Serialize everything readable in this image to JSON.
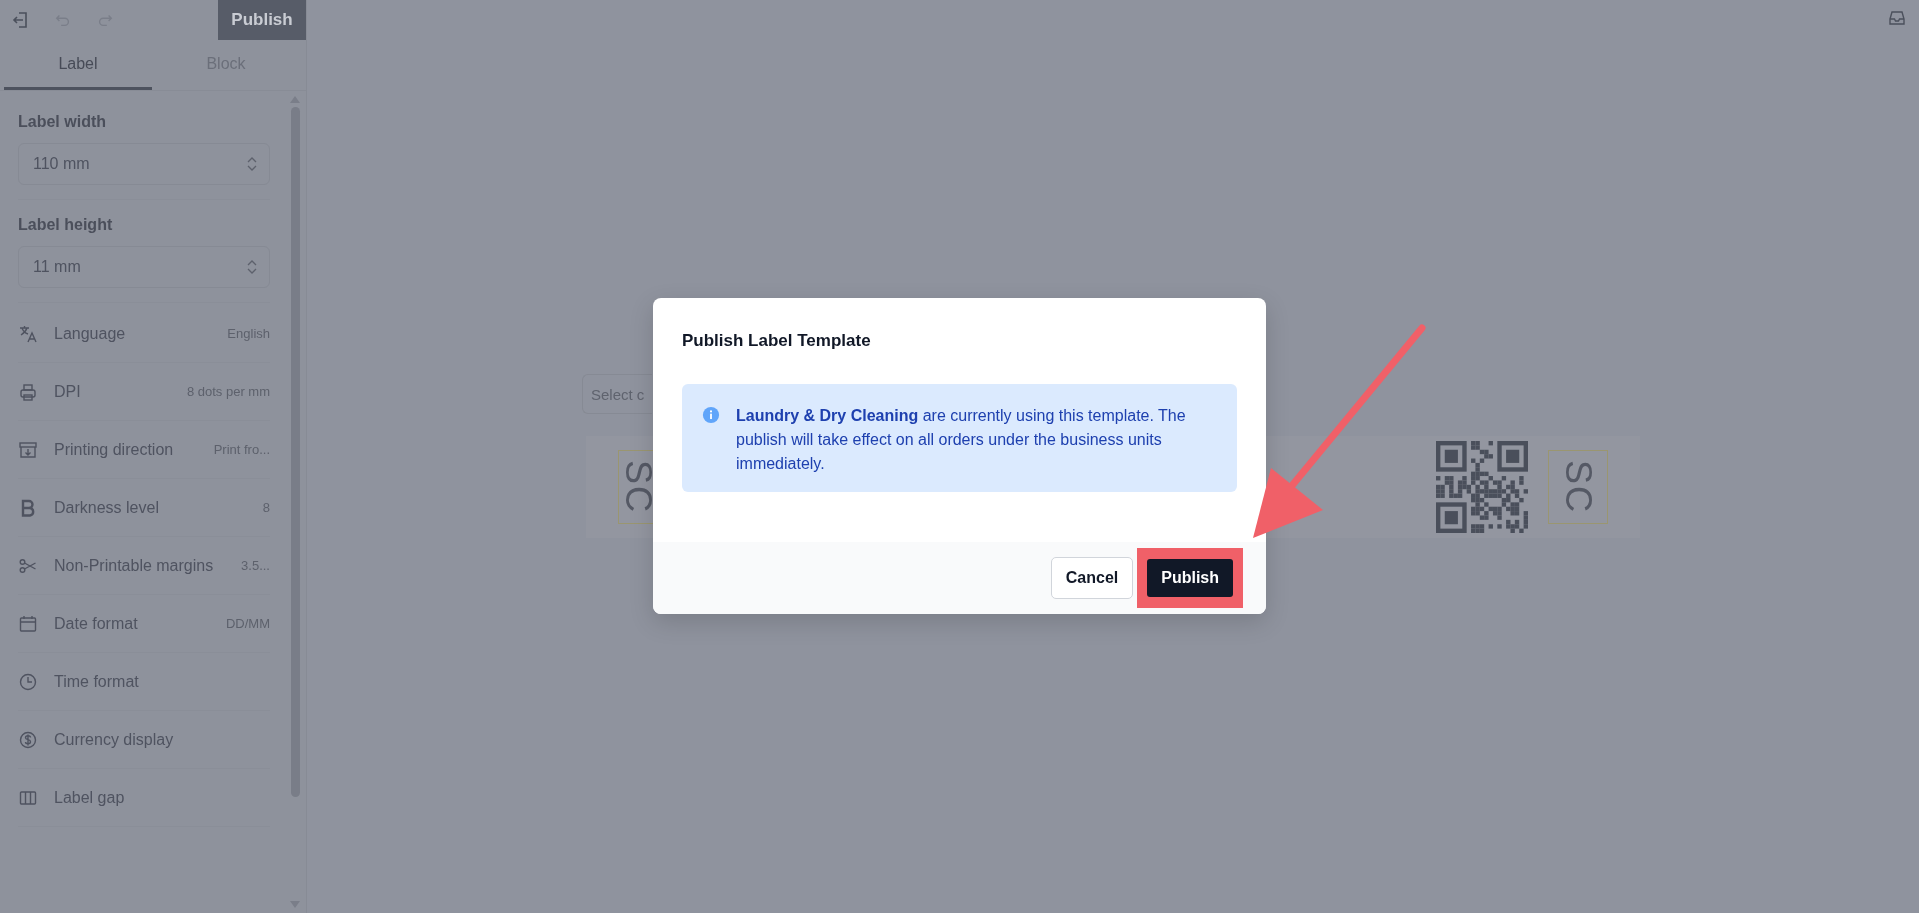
{
  "toolbar": {
    "publish_button": "Publish"
  },
  "tabs": [
    {
      "label": "Label",
      "selected": true
    },
    {
      "label": "Block",
      "selected": false
    }
  ],
  "fields": [
    {
      "label": "Label width",
      "value": "110 mm"
    },
    {
      "label": "Label height",
      "value": "11 mm"
    }
  ],
  "settings": [
    {
      "label": "Language",
      "value": "English"
    },
    {
      "label": "DPI",
      "value": "8 dots per mm"
    },
    {
      "label": "Printing direction",
      "value": "Print fro..."
    },
    {
      "label": "Darkness level",
      "value": "8"
    },
    {
      "label": "Non-Printable margins",
      "value": "3.5..."
    },
    {
      "label": "Date format",
      "value": "DD/MM"
    },
    {
      "label": "Time format"
    },
    {
      "label": "Currency display"
    },
    {
      "label": "Label gap"
    }
  ],
  "canvas": {
    "select_placeholder": "Select c",
    "label_blocks": [
      "SC",
      "SC"
    ]
  },
  "dialog": {
    "title": "Publish Label Template",
    "message": "**Laundry & Dry Cleaning** are currently using this template. The publish will take effect on all orders under the business units immediately.",
    "buttons": [
      {
        "label": "Cancel",
        "kind": "secondary",
        "highlighted": false
      },
      {
        "label": "Publish",
        "kind": "primary",
        "highlighted": true
      }
    ]
  }
}
